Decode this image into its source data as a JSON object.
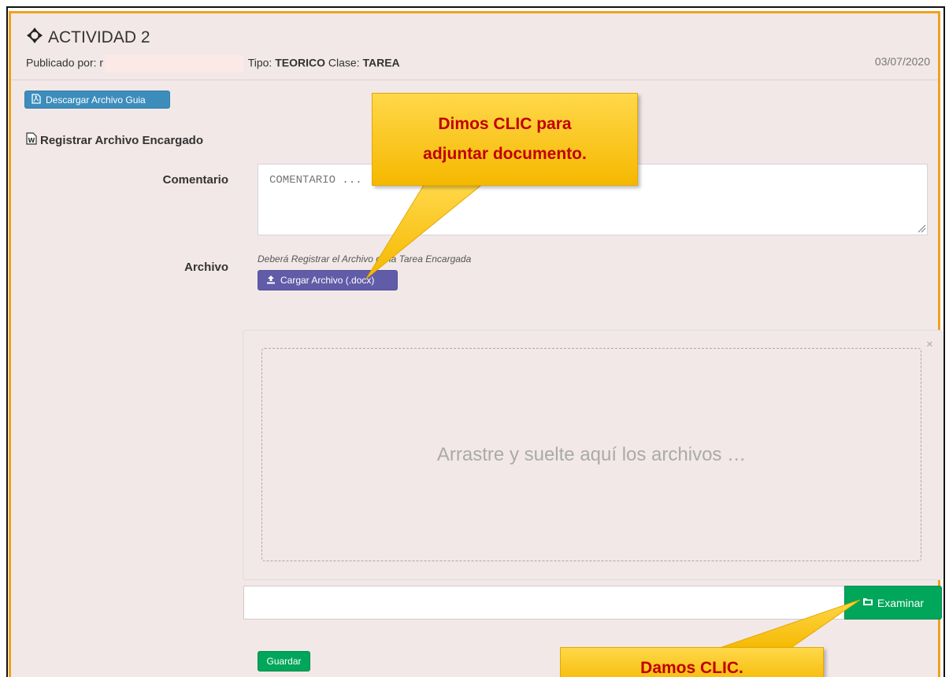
{
  "activity": {
    "title": "ACTIVIDAD 2",
    "published_label": "Publicado por:",
    "published_by": "r",
    "tipo_label": "Tipo:",
    "tipo_value": "TEORICO",
    "clase_label": "Clase:",
    "clase_value": "TAREA",
    "date": "03/07/2020"
  },
  "buttons": {
    "download_guide": "Descargar Archivo Guia",
    "upload_file": "Cargar Archivo (.docx)",
    "browse": "Examinar",
    "save": "Guardar"
  },
  "form": {
    "section_title": "Registrar Archivo Encargado",
    "comment_label": "Comentario",
    "comment_placeholder": "COMENTARIO ...",
    "file_label": "Archivo",
    "file_help": "Deberá Registrar el Archivo de la Tarea Encargada"
  },
  "dropzone": {
    "text": "Arrastre y suelte aquí los archivos …",
    "close": "×"
  },
  "callouts": {
    "attach_line1": "Dimos CLIC para",
    "attach_line2": "adjuntar documento.",
    "click": "Damos CLIC."
  },
  "colors": {
    "accent_border": "#f0a21c",
    "panel_bg": "#f2e8e7",
    "primary": "#3c8dbc",
    "purple": "#605ca8",
    "success": "#00a65a",
    "callout": "#ffc000",
    "callout_text": "#c00000"
  },
  "icons": {
    "title": "crosshairs-icon",
    "download": "file-pdf-icon",
    "section": "file-word-icon",
    "upload": "upload-icon",
    "browse": "folder-open-icon"
  }
}
